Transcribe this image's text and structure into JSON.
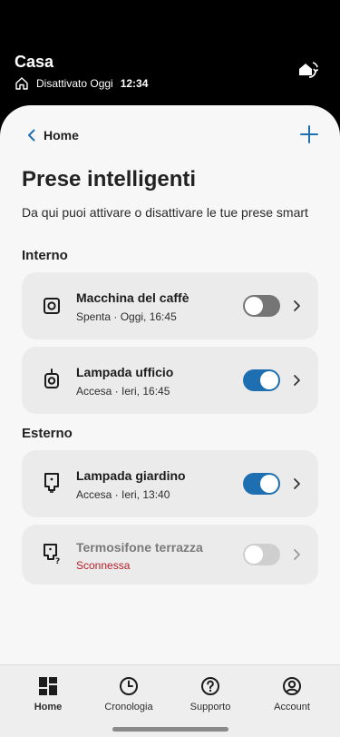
{
  "header": {
    "title": "Casa",
    "status_text": "Disattivato Oggi",
    "status_time": "12:34"
  },
  "nav": {
    "back_label": "Home"
  },
  "page": {
    "title": "Prese intelligenti",
    "description": "Da qui puoi attivare o disattivare le tue prese smart"
  },
  "sections": {
    "interno": "Interno",
    "esterno": "Esterno"
  },
  "devices": [
    {
      "name": "Macchina del caffè",
      "status": "Spenta · Oggi, 16:45",
      "state": "off"
    },
    {
      "name": "Lampada ufficio",
      "status": "Accesa · Ieri, 16:45",
      "state": "on"
    },
    {
      "name": "Lampada giardino",
      "status": "Accesa · Ieri, 13:40",
      "state": "on"
    },
    {
      "name": "Termosifone terrazza",
      "status": "Sconnessa",
      "state": "disconnected"
    }
  ],
  "tabs": [
    {
      "label": "Home",
      "icon": "dashboard-icon",
      "active": true
    },
    {
      "label": "Cronologia",
      "icon": "clock-icon",
      "active": false
    },
    {
      "label": "Supporto",
      "icon": "help-icon",
      "active": false
    },
    {
      "label": "Account",
      "icon": "account-icon",
      "active": false
    }
  ],
  "colors": {
    "accent": "#1e6fb2",
    "error": "#b3202a",
    "header_bg": "#000000",
    "card_bg": "#ebebeb"
  }
}
